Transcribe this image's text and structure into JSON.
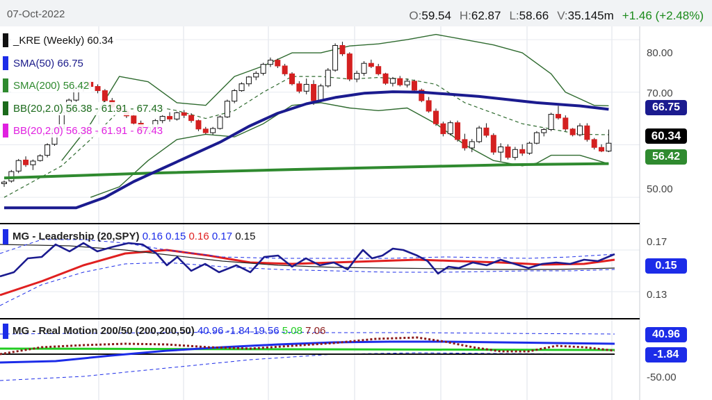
{
  "header": {
    "date": "07-Oct-2022",
    "open_label": "O:",
    "open": "59.54",
    "high_label": "H:",
    "high": "62.87",
    "low_label": "L:",
    "low": "58.66",
    "volume_label": "V:",
    "volume": "35.145m",
    "change": "+1.46 (+2.48%)"
  },
  "price_panel": {
    "legend": [
      {
        "text": "_KRE (Weekly) 60.34",
        "color": "#111111"
      },
      {
        "text": "SMA(50) 66.75",
        "color": "#1a1a8a"
      },
      {
        "text": "SMA(200) 56.42",
        "color": "#2f8a2f"
      },
      {
        "text": "BB(20,2.0) 56.38 - 61.91 - 67.43",
        "color": "#1b6a1b"
      },
      {
        "text": "BB(20,2.0) 56.38 - 61.91 - 67.43",
        "color": "#e020e0"
      }
    ],
    "axis_labels": [
      "80.00",
      "70.00",
      "50.00"
    ],
    "tags": [
      {
        "text": "66.75",
        "color": "#1b1b8f"
      },
      {
        "text": "60.34",
        "color": "#000000"
      },
      {
        "text": "56.42",
        "color": "#2f8a2f"
      }
    ]
  },
  "leadership_panel": {
    "title": "MG - Leadership (20,SPY)",
    "values": [
      "0.16",
      "0.15",
      "0.16",
      "0.17",
      "0.15"
    ],
    "value_colors": [
      "#1c2ce8",
      "#1c2ce8",
      "#e02020",
      "#1c2ce8",
      "#111111"
    ],
    "axis_labels": [
      "0.17",
      "0.13"
    ],
    "tag": "0.15"
  },
  "realmotion_panel": {
    "title": "MG - Real Motion 200/50 (200,200,50)",
    "values": [
      "40.96",
      "-1.84",
      "19.56",
      "5.08",
      "7.06"
    ],
    "value_colors": [
      "#1c2ce8",
      "#1c2ce8",
      "#1c2ce8",
      "#22cc22",
      "#8b1a1a"
    ],
    "axis_labels": [
      "-50.00"
    ],
    "tags": [
      "40.96",
      "-1.84"
    ]
  },
  "chart_data": {
    "type": "candlestick",
    "ticker": "_KRE",
    "interval": "Weekly",
    "last": 60.34,
    "ylim": [
      45,
      82
    ],
    "candles": [
      [
        52.6,
        53.2,
        52.0,
        52.9
      ],
      [
        53.1,
        55.2,
        52.8,
        54.9
      ],
      [
        55.0,
        57.3,
        54.6,
        57.0
      ],
      [
        57.1,
        57.8,
        55.8,
        56.2
      ],
      [
        56.2,
        57.2,
        55.2,
        56.9
      ],
      [
        57.0,
        58.2,
        56.8,
        57.9
      ],
      [
        58.0,
        60.3,
        57.6,
        60.0
      ],
      [
        60.1,
        63.2,
        59.8,
        63.0
      ],
      [
        63.1,
        66.3,
        62.9,
        66.2
      ],
      [
        66.2,
        68.8,
        65.8,
        68.5
      ],
      [
        68.5,
        71.2,
        68.2,
        70.9
      ],
      [
        70.9,
        72.2,
        70.1,
        71.9
      ],
      [
        71.9,
        72.1,
        70.7,
        71.1
      ],
      [
        71.1,
        71.5,
        69.8,
        70.3
      ],
      [
        70.3,
        70.6,
        68.1,
        68.4
      ],
      [
        68.4,
        68.9,
        66.9,
        67.2
      ],
      [
        67.2,
        67.7,
        66.1,
        66.4
      ],
      [
        66.4,
        66.8,
        65.1,
        65.5
      ],
      [
        65.5,
        66.3,
        63.6,
        64.1
      ],
      [
        64.1,
        64.6,
        62.1,
        62.6
      ],
      [
        62.6,
        63.6,
        62.1,
        63.3
      ],
      [
        63.3,
        64.9,
        62.8,
        64.6
      ],
      [
        64.6,
        65.8,
        64.1,
        65.4
      ],
      [
        65.4,
        66.2,
        64.4,
        64.9
      ],
      [
        64.9,
        66.3,
        64.6,
        66.1
      ],
      [
        66.1,
        66.6,
        65.1,
        65.6
      ],
      [
        65.6,
        66.0,
        64.2,
        64.6
      ],
      [
        64.6,
        64.8,
        62.6,
        63.0
      ],
      [
        63.0,
        63.4,
        62.0,
        62.3
      ],
      [
        62.3,
        63.4,
        61.9,
        63.1
      ],
      [
        63.1,
        65.6,
        62.9,
        65.3
      ],
      [
        65.3,
        68.6,
        65.1,
        68.3
      ],
      [
        68.3,
        70.6,
        67.9,
        70.3
      ],
      [
        70.3,
        71.9,
        70.1,
        71.6
      ],
      [
        71.6,
        73.1,
        71.1,
        72.9
      ],
      [
        72.9,
        74.0,
        72.3,
        73.6
      ],
      [
        73.6,
        75.6,
        73.2,
        75.3
      ],
      [
        75.3,
        76.6,
        74.8,
        76.1
      ],
      [
        76.1,
        76.4,
        74.6,
        75.0
      ],
      [
        75.0,
        75.4,
        73.1,
        73.5
      ],
      [
        73.5,
        73.8,
        71.3,
        71.6
      ],
      [
        71.6,
        72.1,
        69.8,
        70.2
      ],
      [
        70.2,
        72.6,
        69.6,
        71.5
      ],
      [
        71.5,
        72.3,
        67.6,
        68.4
      ],
      [
        68.4,
        71.6,
        68.1,
        71.2
      ],
      [
        71.2,
        74.6,
        70.9,
        74.2
      ],
      [
        74.2,
        79.3,
        73.9,
        78.9
      ],
      [
        78.9,
        79.6,
        76.9,
        77.3
      ],
      [
        77.3,
        77.6,
        72.1,
        72.5
      ],
      [
        72.5,
        74.1,
        71.9,
        73.6
      ],
      [
        73.6,
        75.9,
        73.1,
        75.5
      ],
      [
        75.5,
        76.2,
        74.6,
        74.9
      ],
      [
        74.9,
        75.4,
        73.2,
        73.5
      ],
      [
        73.5,
        73.7,
        71.4,
        71.7
      ],
      [
        71.7,
        72.9,
        71.1,
        72.6
      ],
      [
        72.6,
        73.1,
        71.1,
        71.4
      ],
      [
        71.4,
        72.6,
        70.9,
        72.1
      ],
      [
        72.1,
        72.4,
        70.1,
        70.4
      ],
      [
        70.4,
        70.7,
        68.1,
        68.4
      ],
      [
        68.4,
        69.1,
        66.1,
        66.4
      ],
      [
        66.4,
        66.9,
        63.6,
        64.0
      ],
      [
        64.0,
        64.4,
        61.6,
        62.1
      ],
      [
        62.1,
        64.6,
        61.8,
        64.2
      ],
      [
        64.2,
        64.6,
        60.6,
        61.0
      ],
      [
        61.0,
        62.1,
        58.9,
        59.4
      ],
      [
        59.4,
        61.1,
        58.6,
        60.6
      ],
      [
        60.6,
        63.6,
        60.3,
        63.2
      ],
      [
        63.2,
        64.1,
        61.4,
        61.8
      ],
      [
        61.8,
        62.2,
        58.1,
        58.6
      ],
      [
        58.6,
        60.3,
        56.9,
        59.6
      ],
      [
        59.6,
        60.1,
        57.2,
        57.6
      ],
      [
        57.6,
        59.6,
        57.1,
        59.1
      ],
      [
        59.1,
        60.1,
        57.9,
        58.4
      ],
      [
        58.4,
        60.6,
        58.1,
        60.3
      ],
      [
        60.3,
        62.6,
        60.1,
        62.3
      ],
      [
        62.3,
        63.2,
        61.6,
        62.9
      ],
      [
        62.9,
        66.1,
        62.6,
        65.8
      ],
      [
        65.8,
        67.4,
        64.8,
        65.1
      ],
      [
        65.1,
        65.6,
        62.6,
        63.0
      ],
      [
        63.0,
        63.2,
        61.6,
        61.9
      ],
      [
        61.9,
        64.1,
        61.6,
        63.6
      ],
      [
        63.6,
        64.1,
        60.6,
        61.0
      ],
      [
        61.0,
        61.3,
        59.1,
        59.5
      ],
      [
        59.5,
        60.1,
        58.6,
        58.8
      ],
      [
        58.8,
        62.9,
        58.6,
        60.3
      ]
    ],
    "sma50": [
      [
        0,
        48.0
      ],
      [
        10,
        48.0
      ],
      [
        14,
        50.0
      ],
      [
        18,
        53.0
      ],
      [
        22,
        55.5
      ],
      [
        26,
        58.0
      ],
      [
        30,
        60.5
      ],
      [
        34,
        63.5
      ],
      [
        38,
        66.0
      ],
      [
        42,
        67.8
      ],
      [
        46,
        69.0
      ],
      [
        50,
        69.8
      ],
      [
        54,
        70.1
      ],
      [
        58,
        70.0
      ],
      [
        62,
        69.6
      ],
      [
        66,
        69.2
      ],
      [
        70,
        68.6
      ],
      [
        74,
        68.0
      ],
      [
        78,
        67.6
      ],
      [
        80,
        67.4
      ],
      [
        84,
        66.75
      ]
    ],
    "sma200": [
      [
        0,
        53.7
      ],
      [
        20,
        54.6
      ],
      [
        40,
        55.3
      ],
      [
        60,
        55.9
      ],
      [
        70,
        56.2
      ],
      [
        84,
        56.42
      ]
    ],
    "bb_upper": [
      [
        8,
        57.0
      ],
      [
        12,
        64.0
      ],
      [
        16,
        73.0
      ],
      [
        20,
        72.0
      ],
      [
        24,
        68.0
      ],
      [
        28,
        67.5
      ],
      [
        32,
        73.0
      ],
      [
        36,
        75.0
      ],
      [
        40,
        77.5
      ],
      [
        44,
        77.5
      ],
      [
        48,
        78.8
      ],
      [
        52,
        79.2
      ],
      [
        56,
        80.0
      ],
      [
        60,
        81.0
      ],
      [
        64,
        80.0
      ],
      [
        68,
        79.0
      ],
      [
        72,
        77.5
      ],
      [
        76,
        73.5
      ],
      [
        78,
        70.0
      ],
      [
        82,
        67.5
      ],
      [
        84,
        67.43
      ]
    ],
    "bb_middle": [
      [
        0,
        50.0
      ],
      [
        4,
        53.0
      ],
      [
        8,
        56.0
      ],
      [
        12,
        61.0
      ],
      [
        16,
        66.5
      ],
      [
        20,
        67.5
      ],
      [
        24,
        66.5
      ],
      [
        28,
        65.0
      ],
      [
        32,
        66.5
      ],
      [
        36,
        70.0
      ],
      [
        40,
        73.0
      ],
      [
        44,
        73.0
      ],
      [
        48,
        72.5
      ],
      [
        52,
        72.8
      ],
      [
        56,
        72.5
      ],
      [
        60,
        71.5
      ],
      [
        64,
        68.0
      ],
      [
        68,
        66.0
      ],
      [
        72,
        64.0
      ],
      [
        76,
        63.0
      ],
      [
        80,
        62.0
      ],
      [
        84,
        61.91
      ]
    ],
    "bb_lower": [
      [
        12,
        50.0
      ],
      [
        16,
        52.0
      ],
      [
        20,
        57.0
      ],
      [
        24,
        61.0
      ],
      [
        28,
        62.0
      ],
      [
        32,
        61.5
      ],
      [
        36,
        64.0
      ],
      [
        40,
        67.5
      ],
      [
        44,
        68.0
      ],
      [
        48,
        67.0
      ],
      [
        52,
        66.5
      ],
      [
        56,
        67.0
      ],
      [
        60,
        64.0
      ],
      [
        64,
        60.0
      ],
      [
        68,
        57.0
      ],
      [
        70,
        56.5
      ],
      [
        72,
        56.0
      ],
      [
        74,
        56.5
      ],
      [
        76,
        58.0
      ],
      [
        80,
        58.0
      ],
      [
        84,
        56.38
      ]
    ]
  }
}
